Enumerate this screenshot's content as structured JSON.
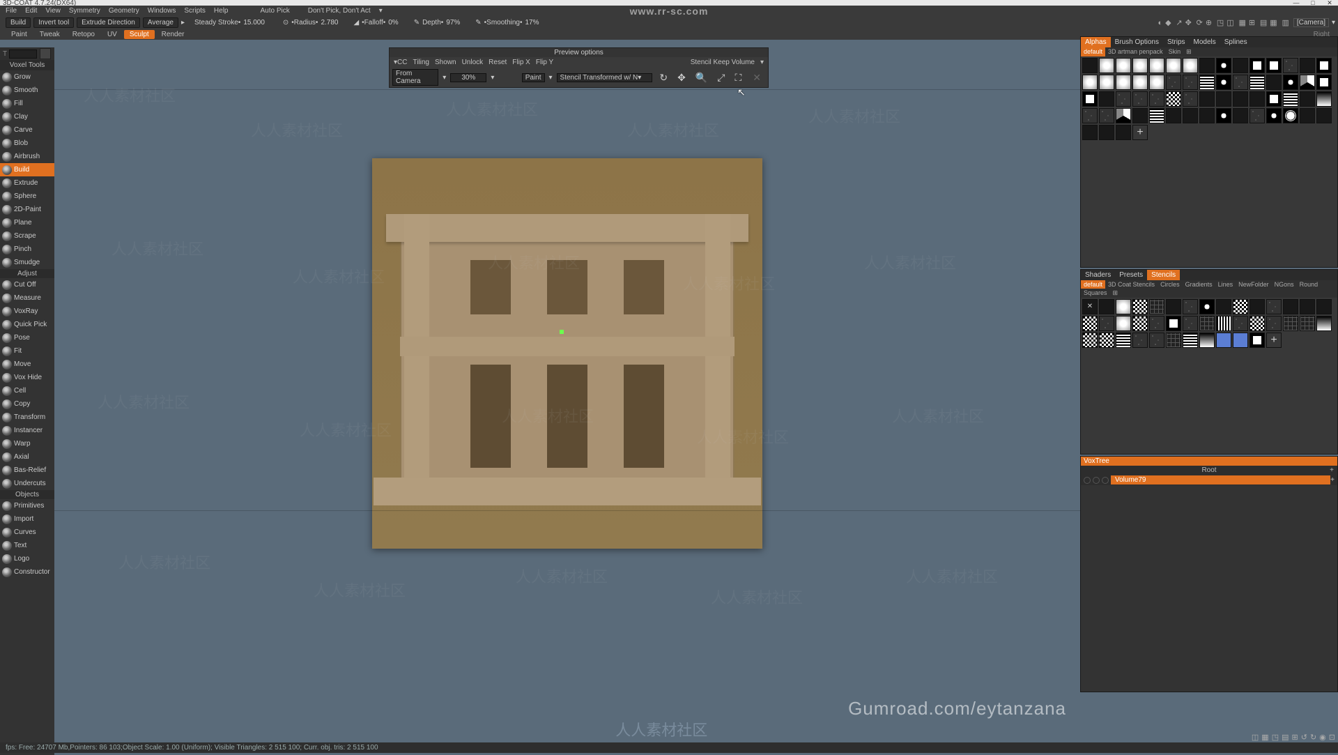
{
  "title": "3D-COAT 4.7.24(DX64)",
  "win_buttons": {
    "min": "—",
    "max": "□",
    "close": "✕"
  },
  "menu": [
    "File",
    "Edit",
    "View",
    "Symmetry",
    "Geometry",
    "Windows",
    "Scripts",
    "Help",
    "",
    "Auto Pick",
    "",
    "Don't Pick, Don't Act",
    "▾"
  ],
  "url": "www.rr-sc.com",
  "params": {
    "build": "Build",
    "invert": "Invert tool",
    "extrude": "Extrude Direction",
    "average": "Average",
    "steady": "Steady Stroke•",
    "steady_val": "15.000",
    "radius": "•Radius•",
    "radius_val": "2.780",
    "falloff": "•Falloff•",
    "falloff_val": "0%",
    "depth": "Depth•",
    "depth_val": "97%",
    "smoothing": "•Smoothing•",
    "smoothing_val": "17%",
    "camera": "[Camera]"
  },
  "mode_tabs": {
    "items": [
      "Paint",
      "Tweak",
      "Retopo",
      "UV",
      "Sculpt",
      "Render"
    ],
    "active": "Sculpt",
    "right": "Right"
  },
  "preview": {
    "title": "Preview options",
    "row1": [
      "▾CC",
      "Tiling",
      "Shown",
      "Unlock",
      "Reset",
      "Flip X",
      "Flip Y",
      "",
      "Stencil Keep Volume",
      "▾"
    ],
    "row2_left_label": "From Camera",
    "row2_left_val": "30%",
    "row2_mid": "Paint",
    "row2_right": "Stencil Transformed w/ N▾",
    "tools": [
      "↻",
      "✥",
      "🔍",
      "⤢",
      "⛶",
      "✕"
    ]
  },
  "voxel_tools_header": "Voxel Tools",
  "tools_a": [
    "Grow",
    "Smooth",
    "Fill",
    "Clay",
    "Carve",
    "Blob",
    "Airbrush",
    "Build",
    "Extrude",
    "Sphere",
    "2D-Paint",
    "Plane",
    "Scrape",
    "Pinch",
    "Smudge"
  ],
  "tools_a_active": "Build",
  "adjust_header": "Adjust",
  "tools_b": [
    "Cut Off",
    "Measure",
    "VoxRay",
    "Quick Pick",
    "Pose",
    "Fit",
    "Move",
    "Vox Hide",
    "Cell",
    "Copy",
    "Transform",
    "Instancer",
    "Warp",
    "Axial",
    "Bas-Relief",
    "Undercuts"
  ],
  "objects_header": "Objects",
  "tools_c": [
    "Primitives",
    "Import",
    "Curves",
    "Text",
    "Logo",
    "Constructor"
  ],
  "right_tabs": {
    "items": [
      "Alphas",
      "Brush Options",
      "Strips",
      "Models",
      "Splines"
    ],
    "active": "Alphas"
  },
  "alpha_subtabs": {
    "items": [
      "default",
      "3D artman penpack",
      "Skin",
      "⊞"
    ],
    "active": "default"
  },
  "stencil_tabs": {
    "items": [
      "Shaders",
      "Presets",
      "Stencils"
    ],
    "active": "Stencils"
  },
  "stencil_subtabs": {
    "items": [
      "default",
      "3D Coat Stencils",
      "Circles",
      "Gradients",
      "Lines",
      "NewFolder",
      "NGons",
      "Round",
      "Squares",
      "⊞"
    ],
    "active": "default"
  },
  "voxtree": {
    "title": "VoxTree",
    "root": "Root",
    "item": "Volume79",
    "add": "+"
  },
  "status": "fps:    Free: 24707 Mb,Pointers: 86 103;Object Scale: 1.00 (Uniform); Visible Triangles: 2 515 100; Curr. obj. tris: 2 515 100",
  "gumroad": "Gumroad.com/eytanzana",
  "rrlogo": "人人素材社区",
  "watermark": "人人素材社区"
}
